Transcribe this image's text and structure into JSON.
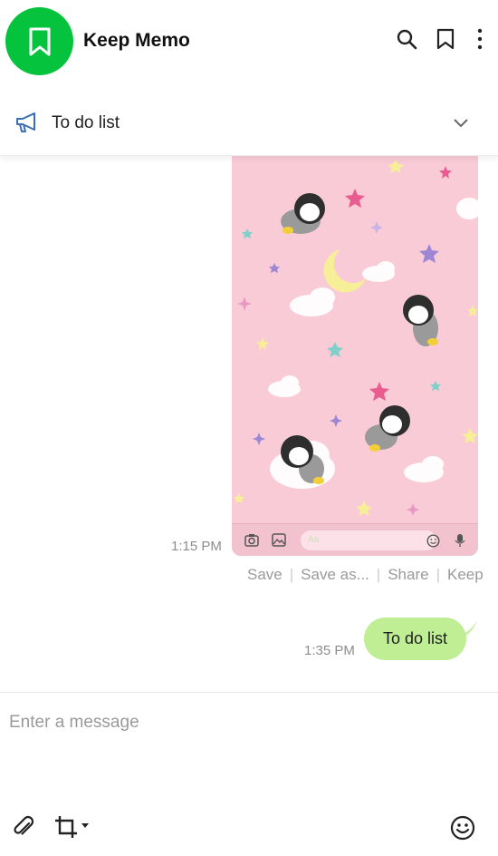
{
  "header": {
    "title": "Keep Memo",
    "avatar_color": "#06c33d",
    "icons": [
      "bookmark-icon",
      "search-icon",
      "bookmark-icon",
      "more-vertical-icon"
    ]
  },
  "notice": {
    "label": "To do list",
    "icon": "megaphone-icon",
    "expand_icon": "chevron-down-icon"
  },
  "messages": [
    {
      "type": "image",
      "time": "1:15 PM",
      "image_bar_placeholder": "Aa",
      "actions": [
        "Save",
        "Save as...",
        "Share",
        "Keep"
      ]
    },
    {
      "type": "text",
      "time": "1:35 PM",
      "text": "To do list",
      "bubble_color": "#c0ee95"
    }
  ],
  "composer": {
    "placeholder": "Enter a message",
    "icons": [
      "paperclip-icon",
      "crop-icon",
      "caret-down-icon",
      "emoji-icon"
    ]
  }
}
